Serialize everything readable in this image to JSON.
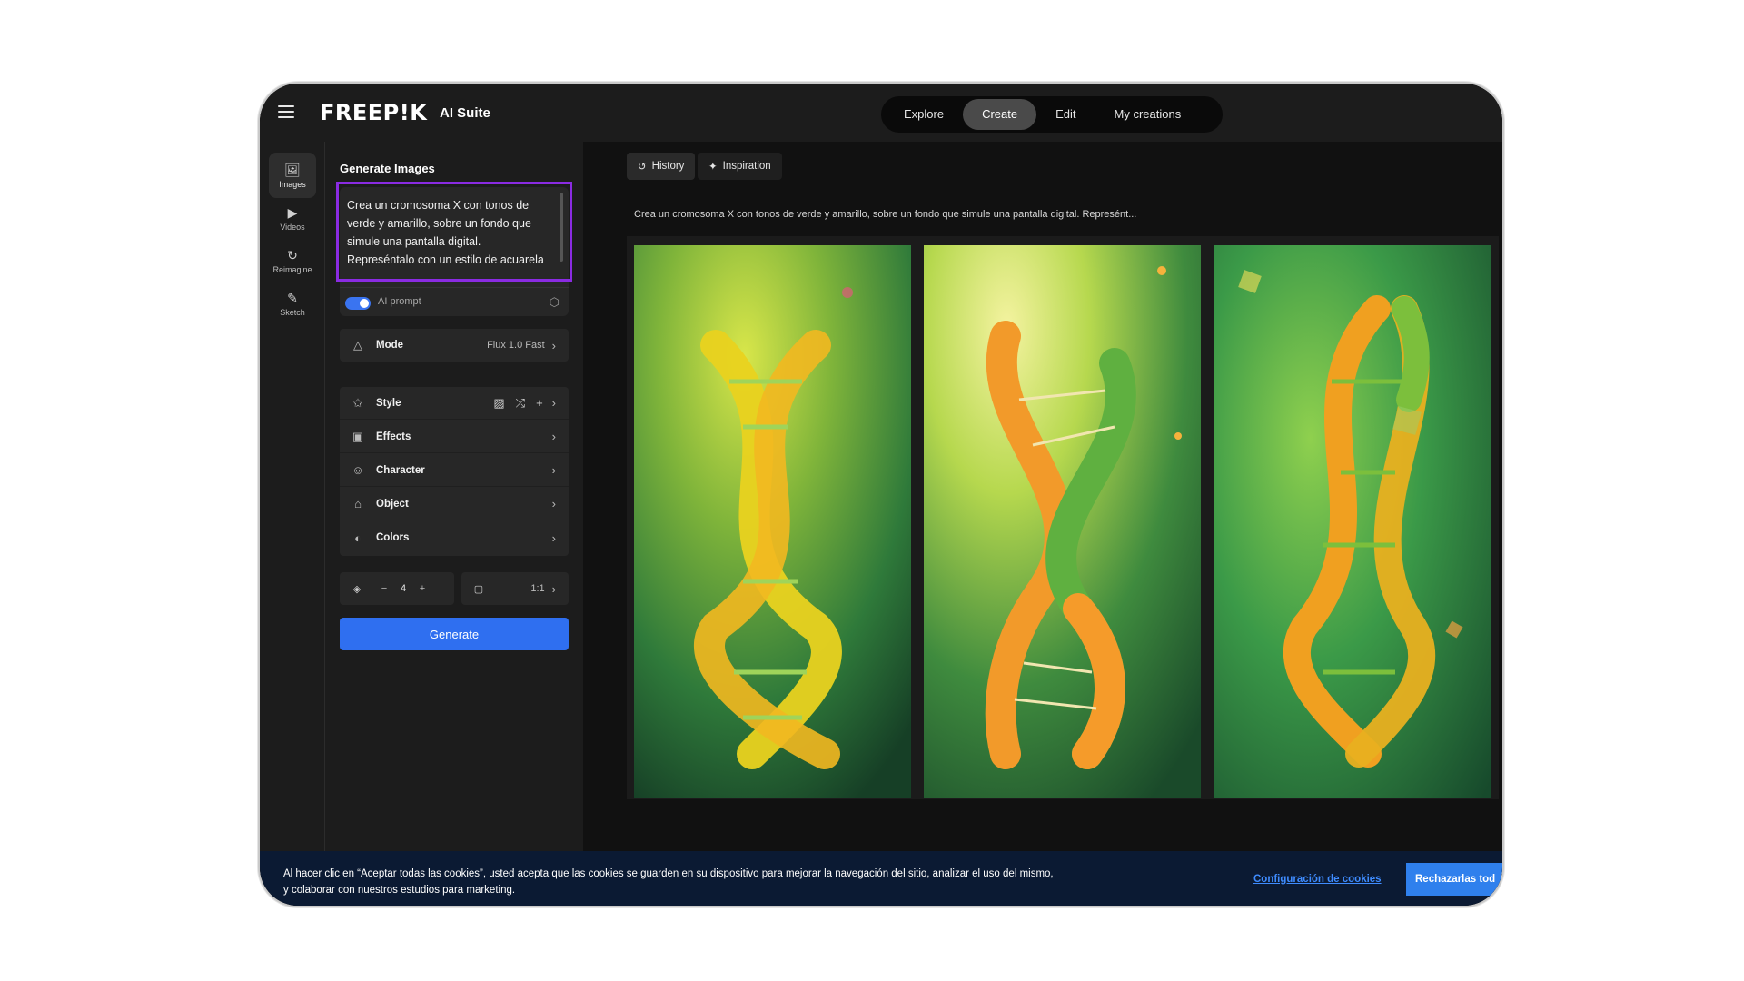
{
  "app": {
    "logo": "FREEP!K",
    "suite_label": "AI Suite"
  },
  "nav": {
    "tabs": [
      "Explore",
      "Create",
      "Edit",
      "My creations"
    ],
    "active": "Create"
  },
  "rail": {
    "items": [
      {
        "label": "Images",
        "icon": "images-icon"
      },
      {
        "label": "Videos",
        "icon": "video-icon"
      },
      {
        "label": "Reimagine",
        "icon": "refresh-icon"
      },
      {
        "label": "Sketch",
        "icon": "brush-icon"
      }
    ]
  },
  "panel": {
    "title": "Generate Images",
    "prompt_text": "Crea un cromosoma X con tonos de verde y amarillo, sobre un fondo que simule una pantalla digital. Represéntalo con un estilo de acuarela",
    "ai_prompt_label": "AI prompt",
    "ai_prompt_enabled": true,
    "mode_label": "Mode",
    "mode_value": "Flux 1.0 Fast",
    "options": [
      "Style",
      "Effects",
      "Character",
      "Object",
      "Colors"
    ],
    "count": "4",
    "minus": "−",
    "plus": "+",
    "ratio": "1:1",
    "generate_label": "Generate",
    "chevron": "›"
  },
  "main": {
    "history_label": "History",
    "inspiration_label": "Inspiration",
    "caption": "Crea un cromosoma X con tonos de verde y amarillo, sobre un fondo que simule una pantalla digital. Represént..."
  },
  "cookie": {
    "text_line1": "Al hacer clic en “Aceptar todas las cookies”, usted acepta que las cookies se guarden en su dispositivo para mejorar la navegación del sitio, analizar el uso del mismo,",
    "text_line2": "y colaborar con nuestros estudios para marketing.",
    "settings_link": "Configuración de cookies",
    "reject_button": "Rechazarlas tod"
  },
  "colors": {
    "accent": "#2f6ff0",
    "highlight": "#8a2be2",
    "cookie_bg": "#0b1a33"
  }
}
